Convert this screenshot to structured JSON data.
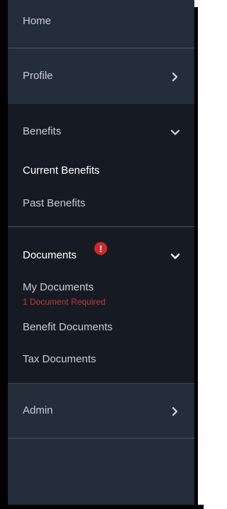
{
  "nav": {
    "home": {
      "label": "Home"
    },
    "profile": {
      "label": "Profile",
      "icon": "chevron-right-icon"
    },
    "benefits": {
      "label": "Benefits",
      "icon": "chevron-down-icon",
      "items": [
        {
          "label": "Current Benefits",
          "active": true
        },
        {
          "label": "Past Benefits",
          "active": false
        }
      ]
    },
    "documents": {
      "label": "Documents",
      "icon": "chevron-down-icon",
      "alert_icon": "exclamation-icon",
      "alert_symbol": "!",
      "items": [
        {
          "label": "My Documents",
          "note": "1 Document Required"
        },
        {
          "label": "Benefit Documents"
        },
        {
          "label": "Tax Documents"
        }
      ]
    },
    "admin": {
      "label": "Admin",
      "icon": "chevron-right-icon"
    }
  },
  "colors": {
    "dark_bg": "#161b23",
    "slate_bg": "#242d3a",
    "text": "#c8ccd3",
    "active_text": "#ffffff",
    "alert": "#d3272b",
    "required_text": "#c0373a"
  }
}
